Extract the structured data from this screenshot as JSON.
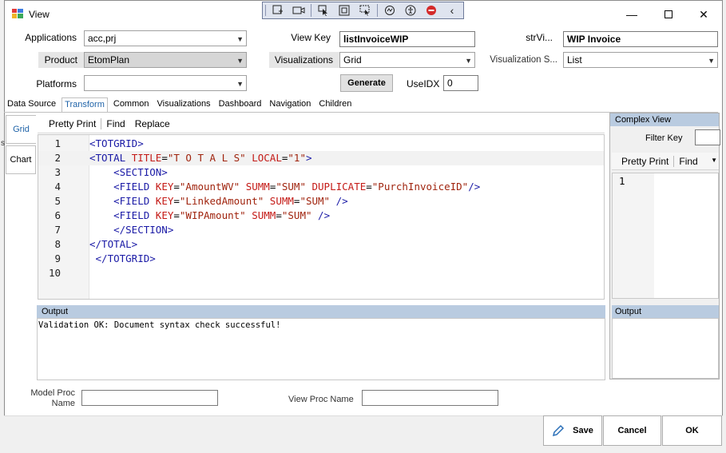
{
  "window": {
    "title": "View"
  },
  "toolbar": {
    "icons": [
      "add-view-icon",
      "video-icon",
      "select-pointer-icon",
      "frame-icon",
      "region-pointer-icon",
      "eye-icon",
      "accessibility-icon",
      "stop-icon",
      "chevron-left-icon"
    ]
  },
  "form": {
    "applications_label": "Applications",
    "applications_value": "acc,prj",
    "product_label": "Product",
    "product_value": "EtomPlan",
    "platforms_label": "Platforms",
    "platforms_value": "",
    "viewkey_label": "View Key",
    "viewkey_value": "listInvoiceWIP",
    "visualizations_label": "Visualizations",
    "visualizations_value": "Grid",
    "generate_label": "Generate",
    "useidx_label": "UseIDX",
    "useidx_value": "0",
    "strvi_label": "strVi...",
    "strvi_value": "WIP Invoice",
    "vis_s_label": "Visualization S...",
    "vis_s_value": "List"
  },
  "tabs": [
    "Data Source",
    "Transform",
    "Common",
    "Visualizations",
    "Dashboard",
    "Navigation",
    "Children"
  ],
  "active_tab": "Transform",
  "vtabs": [
    "Grid",
    "Chart"
  ],
  "editor": {
    "toolbar": [
      "Pretty Print",
      "Find",
      "Replace"
    ],
    "line_numbers": [
      "1",
      "2",
      "3",
      "4",
      "5",
      "6",
      "7",
      "8",
      "9",
      "10"
    ],
    "lines": [
      [
        [
          "t",
          "<TOTGRID>"
        ]
      ],
      [
        [
          "t",
          "<TOTAL "
        ],
        [
          "a",
          "TITLE"
        ],
        [
          "q",
          "="
        ],
        [
          "v",
          "\"T O T A L S\""
        ],
        [
          "a",
          " LOCAL"
        ],
        [
          "q",
          "="
        ],
        [
          "v",
          "\"1\""
        ],
        [
          "t",
          ">"
        ]
      ],
      [
        [
          "t",
          "    <SECTION>"
        ]
      ],
      [
        [
          "t",
          "    <FIELD "
        ],
        [
          "a",
          "KEY"
        ],
        [
          "q",
          "="
        ],
        [
          "v",
          "\"AmountWV\""
        ],
        [
          "a",
          " SUMM"
        ],
        [
          "q",
          "="
        ],
        [
          "v",
          "\"SUM\""
        ],
        [
          "a",
          " DUPLICATE"
        ],
        [
          "q",
          "="
        ],
        [
          "v",
          "\"PurchInvoiceID\""
        ],
        [
          "t",
          "/>"
        ]
      ],
      [
        [
          "t",
          "    <FIELD "
        ],
        [
          "a",
          "KEY"
        ],
        [
          "q",
          "="
        ],
        [
          "v",
          "\"LinkedAmount\""
        ],
        [
          "a",
          " SUMM"
        ],
        [
          "q",
          "="
        ],
        [
          "v",
          "\"SUM\""
        ],
        [
          "t",
          " />"
        ]
      ],
      [
        [
          "t",
          "    <FIELD "
        ],
        [
          "a",
          "KEY"
        ],
        [
          "q",
          "="
        ],
        [
          "v",
          "\"WIPAmount\""
        ],
        [
          "a",
          " SUMM"
        ],
        [
          "q",
          "="
        ],
        [
          "v",
          "\"SUM\""
        ],
        [
          "t",
          " />"
        ]
      ],
      [
        [
          "t",
          "    </SECTION>"
        ]
      ],
      [
        [
          "t",
          "</TOTAL>"
        ]
      ],
      [
        [
          "t",
          " </TOTGRID>"
        ]
      ],
      []
    ],
    "output_label": "Output",
    "output_text": "Validation OK: Document syntax check successful!"
  },
  "complex_view": {
    "title": "Complex View",
    "filter_key_label": "Filter Key",
    "toolbar": [
      "Pretty Print",
      "Find"
    ],
    "line_numbers": [
      "1"
    ],
    "output_label": "Output"
  },
  "bottom": {
    "model_proc_label": "Model Proc\nName",
    "view_proc_label": "View Proc Name"
  },
  "footer": {
    "save": "Save",
    "cancel": "Cancel",
    "ok": "OK"
  }
}
